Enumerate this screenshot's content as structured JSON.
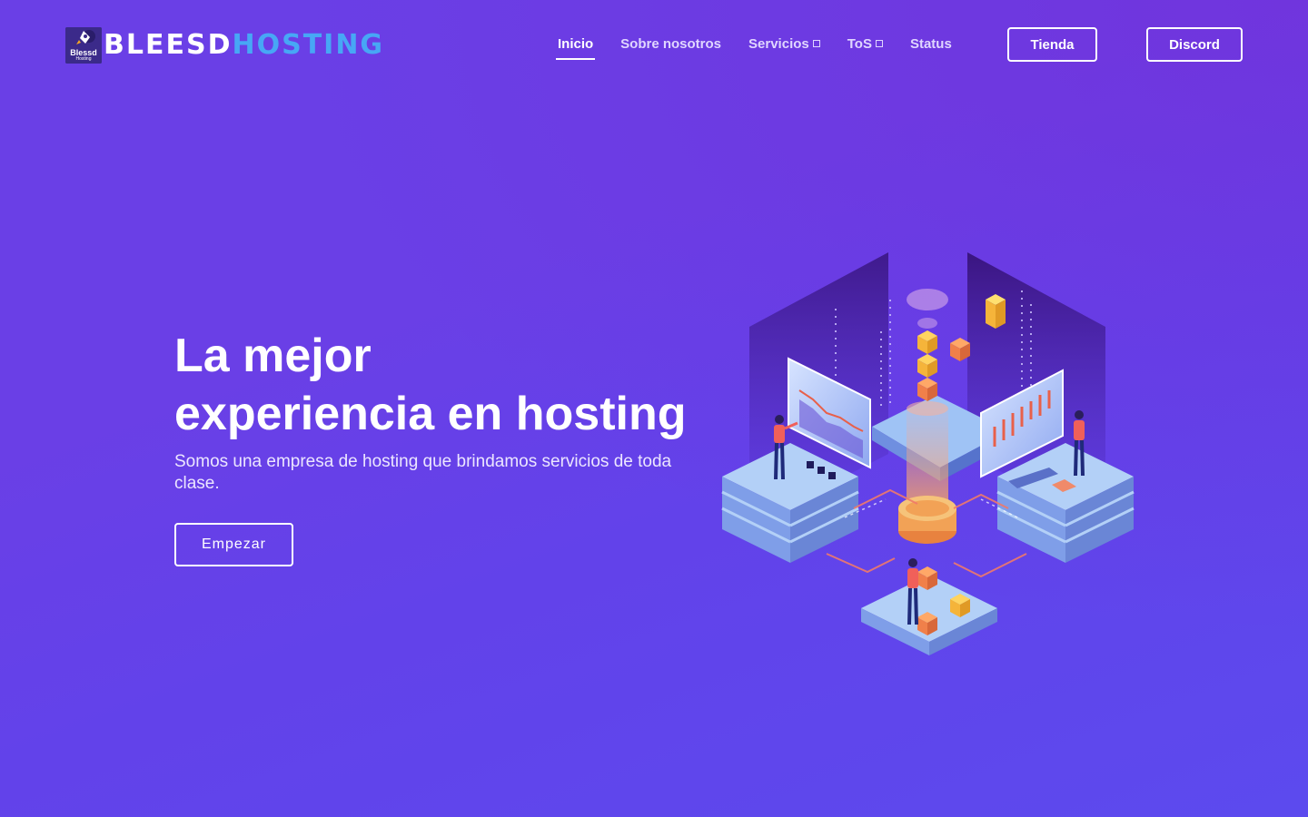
{
  "brand": {
    "logo_text": "Blessd",
    "logo_subtext": "Hosting",
    "name_part1": "BLEESD",
    "name_part2": "HOSTING",
    "name_color_1": "#ffffff",
    "name_color_2": "#47a7f5"
  },
  "nav": {
    "items": [
      {
        "label": "Inicio",
        "active": true
      },
      {
        "label": "Sobre nosotros",
        "active": false
      },
      {
        "label": "Servicios",
        "active": false,
        "dropdown": true
      },
      {
        "label": "ToS",
        "active": false,
        "dropdown": true
      },
      {
        "label": "Status",
        "active": false
      }
    ],
    "buttons": {
      "tienda": "Tienda",
      "discord": "Discord"
    }
  },
  "hero": {
    "title_line1": "La mejor",
    "title_line2": "experiencia en hosting",
    "subtitle": "Somos una empresa de hosting que brindamos servicios de toda clase.",
    "cta": "Empezar"
  },
  "colors": {
    "background_start": "#6a3fe6",
    "background_end": "#5c4aee",
    "accent_blue": "#47a7f5"
  },
  "illustration": {
    "icon": "isometric-server-illustration"
  }
}
